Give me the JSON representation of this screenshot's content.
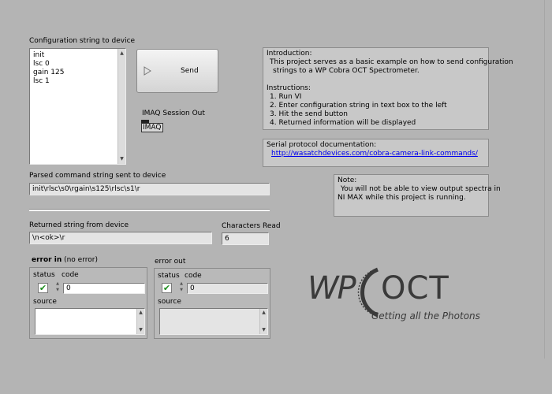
{
  "config": {
    "label": "Configuration string to device",
    "lines": [
      "init",
      "lsc 0",
      "gain 125",
      "lsc 1"
    ]
  },
  "send_button": {
    "label": "Send"
  },
  "imaq": {
    "label": "IMAQ Session Out",
    "value": "IMAQ"
  },
  "intro": {
    "title": "Introduction:",
    "body1": "This project serves as a basic example on how to send configuration",
    "body2": "strings to a WP Cobra OCT Spectrometer.",
    "instructions_title": "Instructions:",
    "steps": [
      "1. Run VI",
      "2. Enter configuration string in text box to the left",
      "3. Hit the send button",
      "4. Returned information will be displayed"
    ]
  },
  "serial": {
    "title": "Serial protocol documentation:",
    "link": "http://wasatchdevices.com/cobra-camera-link-commands/"
  },
  "note": {
    "title": "Note:",
    "line1": "You will not be able to view output spectra in",
    "line2": "NI MAX while this project is running."
  },
  "parsed": {
    "label": "Parsed command string sent to device",
    "value": "init\\rlsc\\s0\\rgain\\s125\\rlsc\\s1\\r"
  },
  "returned": {
    "label": "Returned string from device",
    "value": "\\n<ok>\\r"
  },
  "chars_read": {
    "label": "Characters Read",
    "value": "6"
  },
  "error_in": {
    "label_bold": "error in",
    "label_suffix": " (no error)",
    "status_label": "status",
    "code_label": "code",
    "code_value": "0",
    "source_label": "source",
    "source_value": ""
  },
  "error_out": {
    "label": "error out",
    "status_label": "status",
    "code_label": "code",
    "code_value": "0",
    "source_label": "source",
    "source_value": ""
  },
  "logo": {
    "brand": "WP",
    "product": "OCT",
    "tagline": "Getting all the Photons",
    "color": "#3a3a3a"
  },
  "icons": {
    "checkmark": "check-icon",
    "send_arrow": "play-arrow-icon"
  }
}
